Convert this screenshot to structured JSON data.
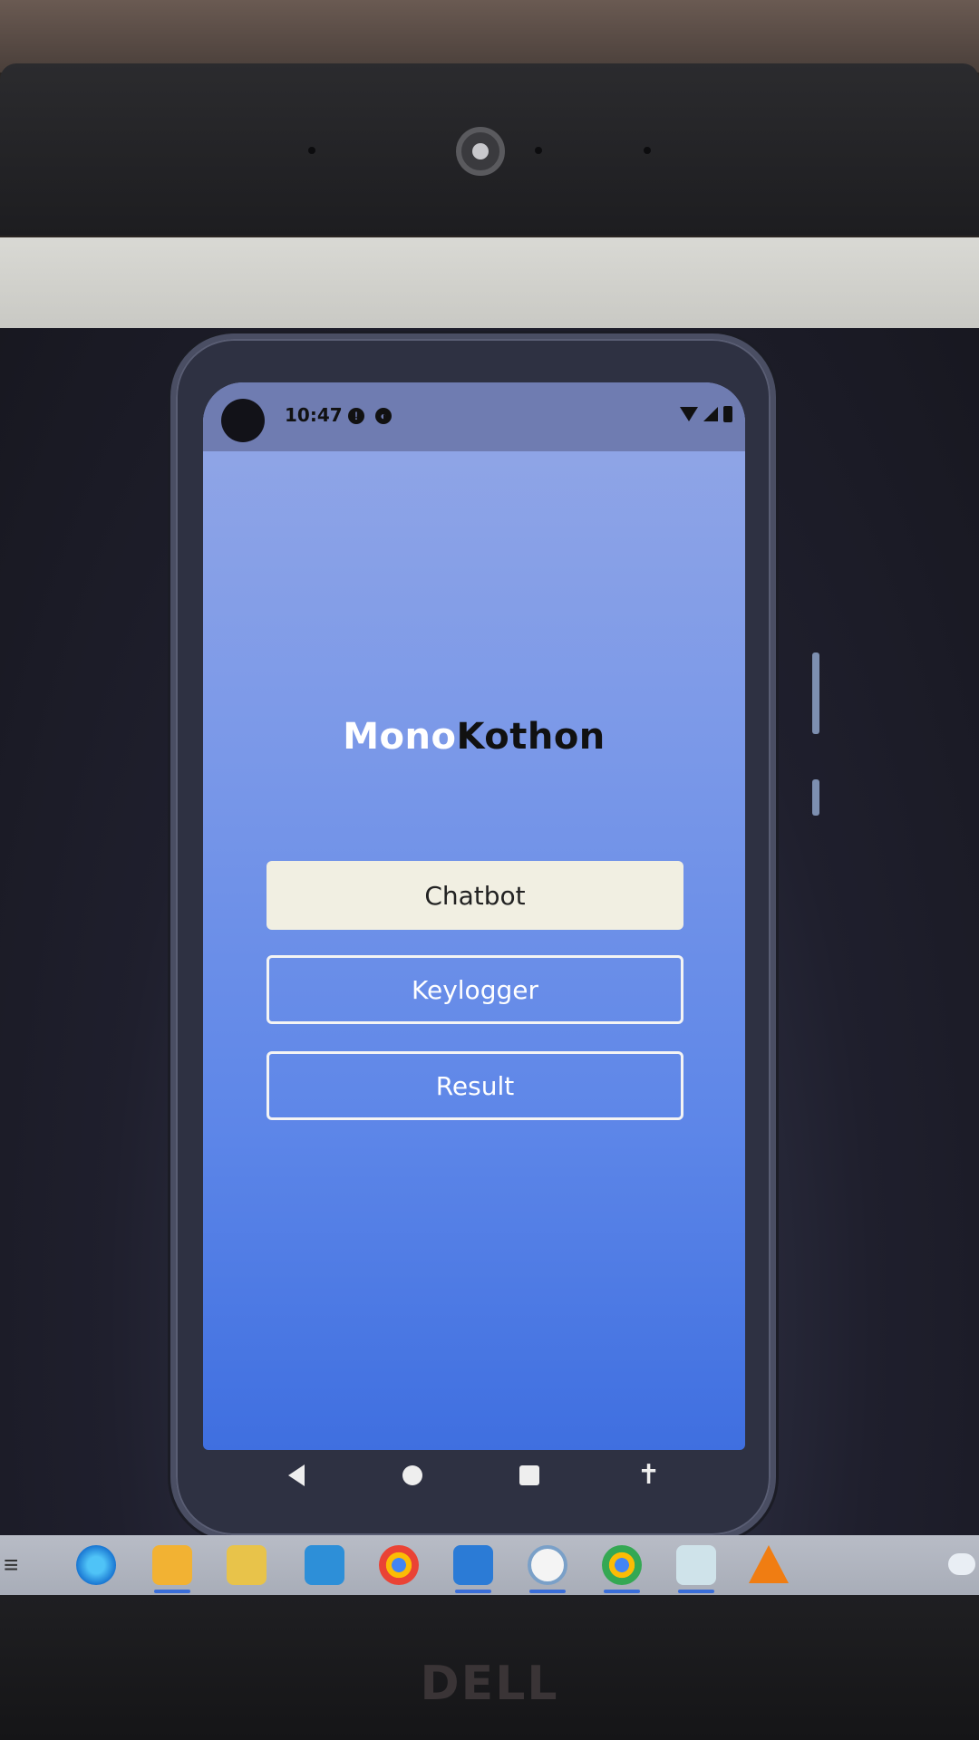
{
  "phone": {
    "status_bar": {
      "time": "10:47",
      "left_icons": [
        "notification-icon-a",
        "notification-icon-b"
      ],
      "right_icons": [
        "wifi-icon",
        "signal-icon",
        "battery-icon"
      ]
    },
    "app": {
      "title_part1": "Mono",
      "title_part2": "Kothon",
      "buttons": [
        {
          "label": "Chatbot",
          "style": "filled"
        },
        {
          "label": "Keylogger",
          "style": "outlined"
        },
        {
          "label": "Result",
          "style": "outlined"
        }
      ]
    },
    "nav_bar": [
      "back-icon",
      "home-icon",
      "recents-icon",
      "accessibility-icon"
    ]
  },
  "taskbar": {
    "apps": [
      "task-view-icon",
      "edge-icon",
      "file-explorer-icon",
      "store-icon",
      "mail-icon",
      "chrome-icon",
      "vscode-icon",
      "app-icon",
      "chrome-icon-2",
      "notepad-icon",
      "vlc-icon",
      "weather-icon"
    ]
  },
  "brand": "DELL",
  "colors": {
    "screen_gradient_top": "#93a7e6",
    "screen_gradient_bottom": "#3f6fe0",
    "status_bar": "#6f7cb1",
    "primary_button": "#f1efe2"
  }
}
